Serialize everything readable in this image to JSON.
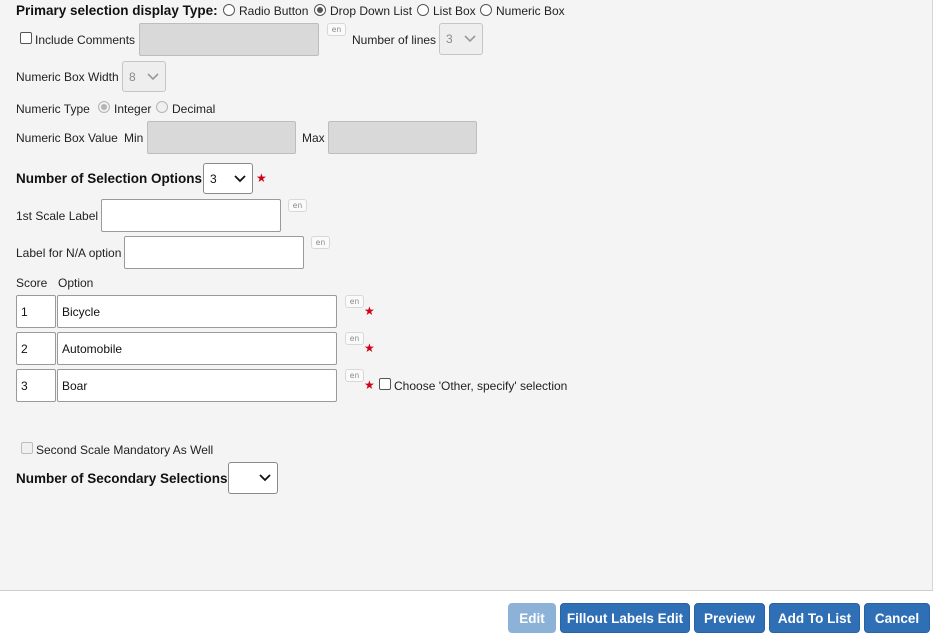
{
  "display_type": {
    "label": "Primary selection display Type:",
    "options": [
      "Radio Button",
      "Drop Down List",
      "List Box",
      "Numeric Box"
    ],
    "selected": "Drop Down List"
  },
  "include_comments": {
    "label": "Include Comments",
    "checked": false,
    "lang_tag": "en"
  },
  "number_of_lines": {
    "label": "Number of lines",
    "value": "3"
  },
  "numeric_box_width": {
    "label": "Numeric Box Width",
    "value": "8"
  },
  "numeric_type": {
    "label": "Numeric Type",
    "options": [
      "Integer",
      "Decimal"
    ],
    "selected": "Integer"
  },
  "numeric_box_value": {
    "label": "Numeric Box Value",
    "min_label": "Min",
    "max_label": "Max",
    "min": "",
    "max": ""
  },
  "selection_options_count": {
    "label": "Number of Selection Options",
    "value": "3"
  },
  "first_scale_label": {
    "label": "1st Scale Label",
    "value": "",
    "lang_tag": "en"
  },
  "na_option_label": {
    "label": "Label for N/A option",
    "value": "",
    "lang_tag": "en"
  },
  "options_table": {
    "headers": [
      "Score",
      "Option"
    ],
    "rows": [
      {
        "score": "1",
        "option": "Bicycle",
        "lang_tag": "en"
      },
      {
        "score": "2",
        "option": "Automobile",
        "lang_tag": "en"
      },
      {
        "score": "3",
        "option": "Boar",
        "lang_tag": "en"
      }
    ],
    "other_specify_label": "Choose 'Other, specify' selection"
  },
  "second_scale_mandatory": {
    "label": "Second Scale Mandatory As Well",
    "checked": false
  },
  "secondary_selections": {
    "label": "Number of Secondary Selections",
    "value": ""
  },
  "required_marker": "★",
  "buttons": {
    "edit": "Edit",
    "fillout_labels_edit": "Fillout Labels Edit",
    "preview": "Preview",
    "add_to_list": "Add To List",
    "cancel": "Cancel"
  },
  "colors": {
    "button": "#2f6fb5",
    "button_disabled": "#8db2d8",
    "required": "#d0021b",
    "panel": "#f4f4f4"
  }
}
